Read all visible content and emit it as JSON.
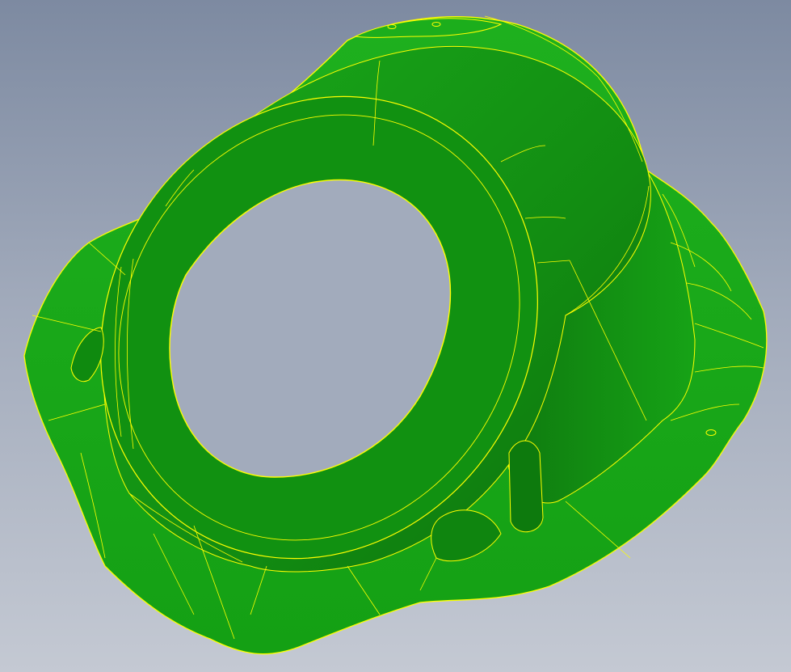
{
  "viewport": {
    "background_top": "#7d8aa1",
    "background_bottom": "#c4c9d3"
  },
  "model": {
    "face_color": "#16a316",
    "face_dark_color": "#0e800e",
    "edge_color": "#ffff00"
  }
}
